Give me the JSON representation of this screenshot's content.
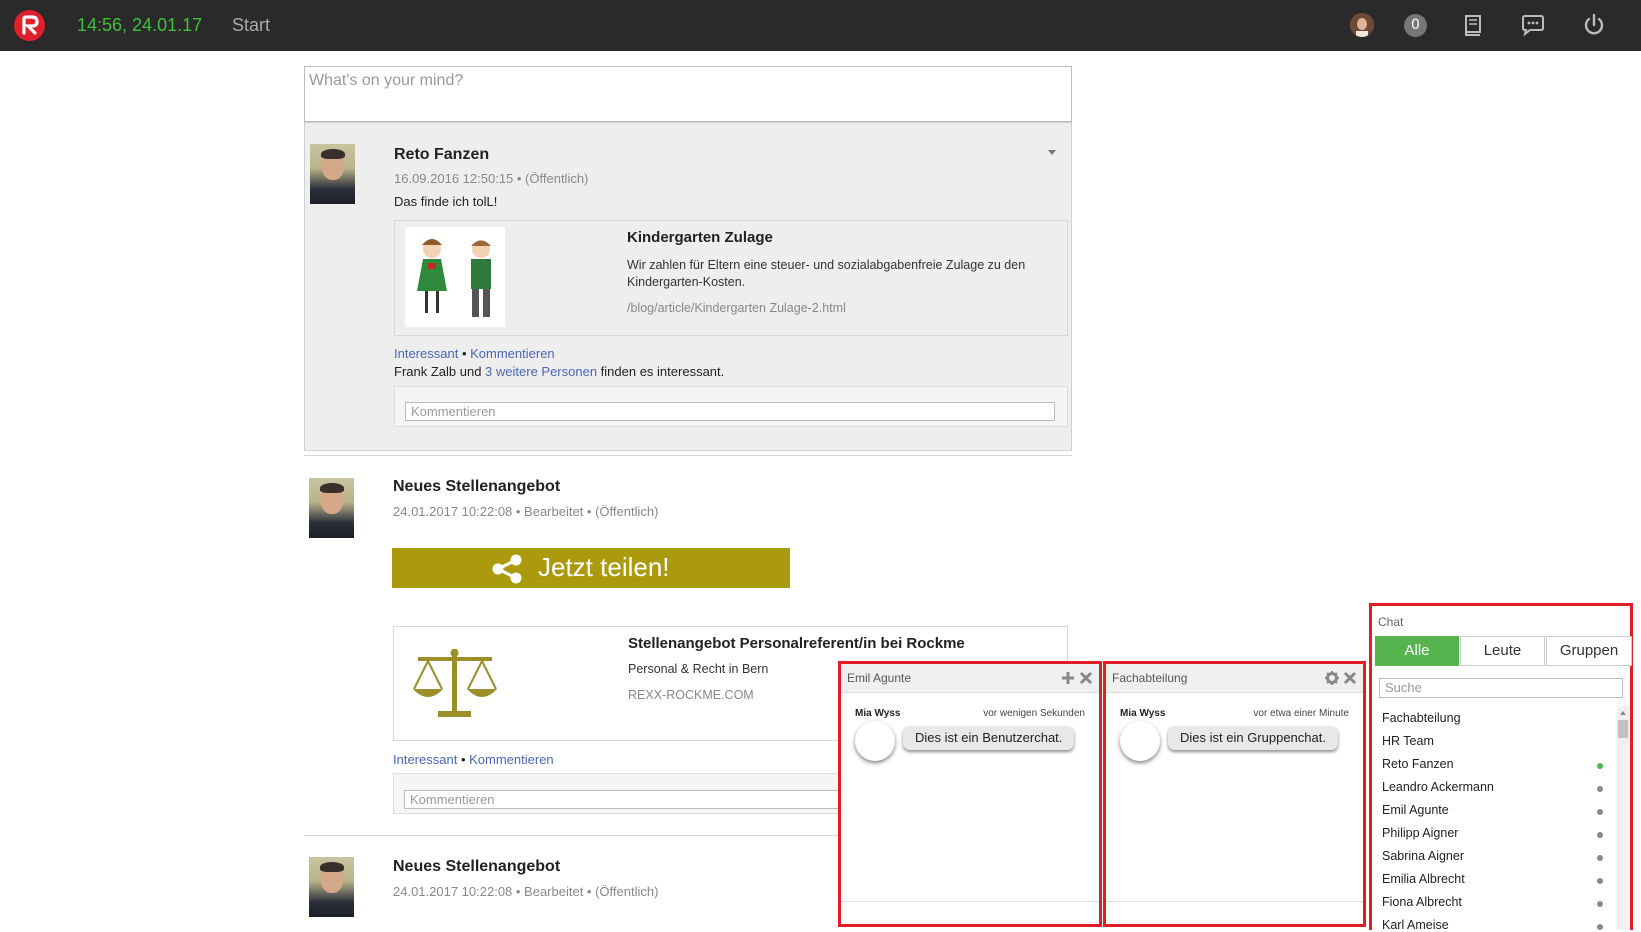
{
  "topbar": {
    "clock": "14:56, 24.01.17",
    "start_label": "Start",
    "notification_count": "0"
  },
  "compose": {
    "placeholder": "What's on your mind?"
  },
  "posts": [
    {
      "author": "Reto Fanzen",
      "meta": "16.09.2016 12:50:15 • (Öffentlich)",
      "text": "Das finde ich tolL!",
      "card": {
        "title": "Kindergarten Zulage",
        "description": "Wir zahlen für Eltern eine steuer- und sozialabgabenfreie Zulage zu den Kindergarten-Kosten.",
        "url": "/blog/article/Kindergarten Zulage-2.html"
      },
      "actions": {
        "interesting": "Interessant",
        "sep": " • ",
        "comment": "Kommentieren"
      },
      "likes": {
        "prefix": "Frank Zalb und ",
        "link": "3 weitere Personen",
        "suffix": " finden es interessant."
      },
      "comment_placeholder": "Kommentieren"
    },
    {
      "author": "Neues Stellenangebot",
      "meta": "24.01.2017 10:22:08 • Bearbeitet • (Öffentlich)",
      "share_label": "Jetzt teilen!",
      "card": {
        "title": "Stellenangebot Personalreferent/in bei Rockme",
        "description": "Personal & Recht in Bern",
        "url": "REXX-ROCKME.COM"
      },
      "actions": {
        "interesting": "Interessant",
        "sep": " • ",
        "comment": "Kommentieren"
      },
      "comment_placeholder": "Kommentieren"
    },
    {
      "author": "Neues Stellenangebot",
      "meta": "24.01.2017 10:22:08 • Bearbeitet • (Öffentlich)"
    }
  ],
  "chat_windows": [
    {
      "title": "Emil Agunte",
      "sender": "Mia Wyss",
      "time": "vor wenigen Sekunden",
      "message": "Dies ist ein Benutzerchat."
    },
    {
      "title": "Fachabteilung",
      "sender": "Mia Wyss",
      "time": "vor etwa einer Minute",
      "message": "Dies ist ein Gruppenchat."
    }
  ],
  "chat_panel": {
    "title": "Chat",
    "tabs": [
      "Alle",
      "Leute",
      "Gruppen"
    ],
    "active_tab": "Alle",
    "search_placeholder": "Suche",
    "contacts": [
      {
        "name": "Fachabteilung",
        "status": "none"
      },
      {
        "name": "HR Team",
        "status": "none"
      },
      {
        "name": "Reto Fanzen",
        "status": "online"
      },
      {
        "name": "Leandro Ackermann",
        "status": "offline"
      },
      {
        "name": "Emil Agunte",
        "status": "offline"
      },
      {
        "name": "Philipp Aigner",
        "status": "offline"
      },
      {
        "name": "Sabrina Aigner",
        "status": "offline"
      },
      {
        "name": "Emilia Albrecht",
        "status": "offline"
      },
      {
        "name": "Fiona Albrecht",
        "status": "offline"
      },
      {
        "name": "Karl Ameise",
        "status": "offline"
      }
    ]
  },
  "colors": {
    "accent_green": "#3fc03a",
    "brand_red": "#e0202a",
    "share_gold": "#ab9a0e",
    "link_blue": "#4a67b8",
    "tab_active": "#55b44e",
    "highlight_red": "#e21d24"
  }
}
